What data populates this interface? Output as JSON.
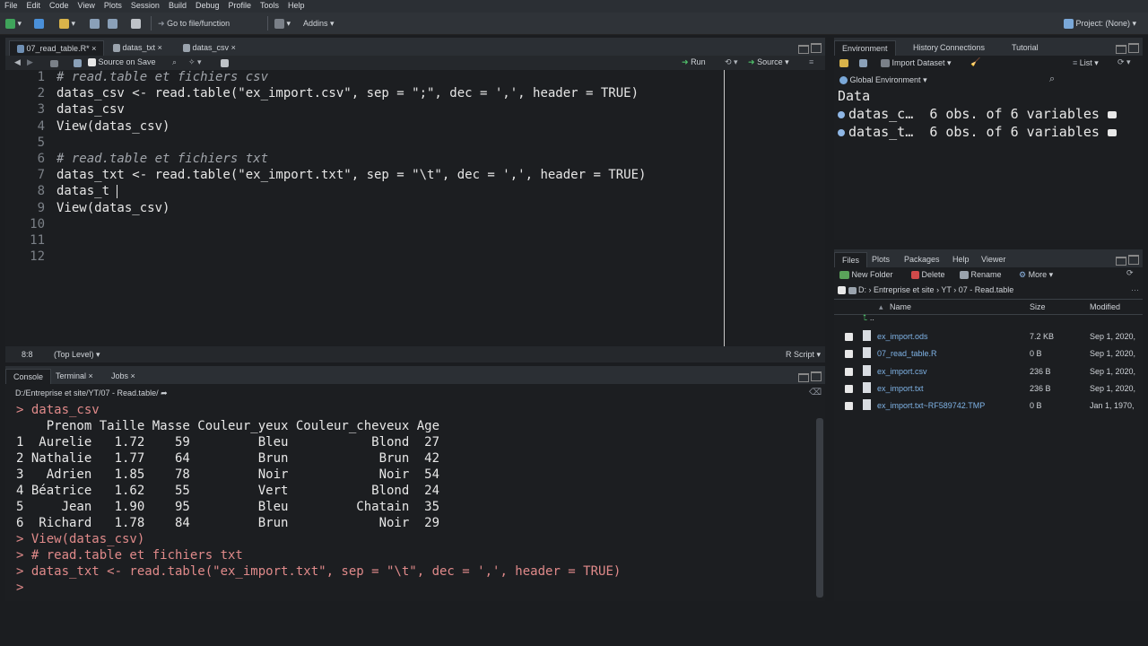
{
  "menu": [
    "File",
    "Edit",
    "Code",
    "View",
    "Plots",
    "Session",
    "Build",
    "Debug",
    "Profile",
    "Tools",
    "Help"
  ],
  "toolbar": {
    "goto": "Go to file/function",
    "addins": "Addins",
    "project": "Project: (None)"
  },
  "editor": {
    "tabs": [
      "07_read_table.R*",
      "datas_txt",
      "datas_csv"
    ],
    "source_on_save": "Source on Save",
    "run": "Run",
    "source": "Source",
    "lines": [
      {
        "n": "1",
        "t": "# read.table et fichiers csv",
        "c": true
      },
      {
        "n": "2",
        "t": "datas_csv <- read.table(\"ex_import.csv\", sep = \";\", dec = ',', header = TRUE)",
        "c": false
      },
      {
        "n": "3",
        "t": "datas_csv",
        "c": false
      },
      {
        "n": "4",
        "t": "View(datas_csv)",
        "c": false
      },
      {
        "n": "5",
        "t": "",
        "c": false
      },
      {
        "n": "6",
        "t": "# read.table et fichiers txt",
        "c": true
      },
      {
        "n": "7",
        "t": "datas_txt <- read.table(\"ex_import.txt\", sep = \"\\t\", dec = ',', header = TRUE)",
        "c": false
      },
      {
        "n": "8",
        "t": "datas_t",
        "c": false
      },
      {
        "n": "9",
        "t": "View(datas_csv)",
        "c": false
      },
      {
        "n": "10",
        "t": "",
        "c": false
      },
      {
        "n": "11",
        "t": "",
        "c": false
      },
      {
        "n": "12",
        "t": "",
        "c": false
      }
    ],
    "status_pos": "8:8",
    "status_scope": "(Top Level)",
    "status_type": "R Script"
  },
  "console": {
    "tabs": [
      "Console",
      "Terminal",
      "Jobs"
    ],
    "path": "D:/Entreprise et site/YT/07 - Read.table/",
    "lines": [
      {
        "p": true,
        "t": "> datas_csv"
      },
      {
        "p": false,
        "t": "    Prenom Taille Masse Couleur_yeux Couleur_cheveux Age"
      },
      {
        "p": false,
        "t": "1  Aurelie   1.72    59         Bleu           Blond  27"
      },
      {
        "p": false,
        "t": "2 Nathalie   1.77    64         Brun            Brun  42"
      },
      {
        "p": false,
        "t": "3   Adrien   1.85    78         Noir            Noir  54"
      },
      {
        "p": false,
        "t": "4 Béatrice   1.62    55         Vert           Blond  24"
      },
      {
        "p": false,
        "t": "5     Jean   1.90    95         Bleu         Chatain  35"
      },
      {
        "p": false,
        "t": "6  Richard   1.78    84         Brun            Noir  29"
      },
      {
        "p": true,
        "t": "> View(datas_csv)"
      },
      {
        "p": true,
        "t": "> # read.table et fichiers txt"
      },
      {
        "p": true,
        "t": "> datas_txt <- read.table(\"ex_import.txt\", sep = \"\\t\", dec = ',', header = TRUE)"
      },
      {
        "p": true,
        "t": "> "
      }
    ]
  },
  "environment": {
    "tabs": [
      "Environment",
      "History",
      "Connections",
      "Tutorial"
    ],
    "import": "Import Dataset",
    "view_mode": "List",
    "scope": "Global Environment",
    "section": "Data",
    "rows": [
      {
        "name": "datas_c…",
        "desc": "6 obs. of 6 variables"
      },
      {
        "name": "datas_t…",
        "desc": "6 obs. of 6 variables"
      }
    ]
  },
  "files": {
    "tabs": [
      "Files",
      "Plots",
      "Packages",
      "Help",
      "Viewer"
    ],
    "new_folder": "New Folder",
    "delete": "Delete",
    "rename": "Rename",
    "more": "More",
    "breadcrumb": [
      "D:",
      "Entreprise et site",
      "YT",
      "07 - Read.table"
    ],
    "cols": {
      "name": "Name",
      "size": "Size",
      "modified": "Modified"
    },
    "up": "..",
    "rows": [
      {
        "name": "ex_import.ods",
        "size": "7.2 KB",
        "modified": "Sep 1, 2020,"
      },
      {
        "name": "07_read_table.R",
        "size": "0 B",
        "modified": "Sep 1, 2020,"
      },
      {
        "name": "ex_import.csv",
        "size": "236 B",
        "modified": "Sep 1, 2020,"
      },
      {
        "name": "ex_import.txt",
        "size": "236 B",
        "modified": "Sep 1, 2020,"
      },
      {
        "name": "ex_import.txt~RF589742.TMP",
        "size": "0 B",
        "modified": "Jan 1, 1970,"
      }
    ]
  }
}
